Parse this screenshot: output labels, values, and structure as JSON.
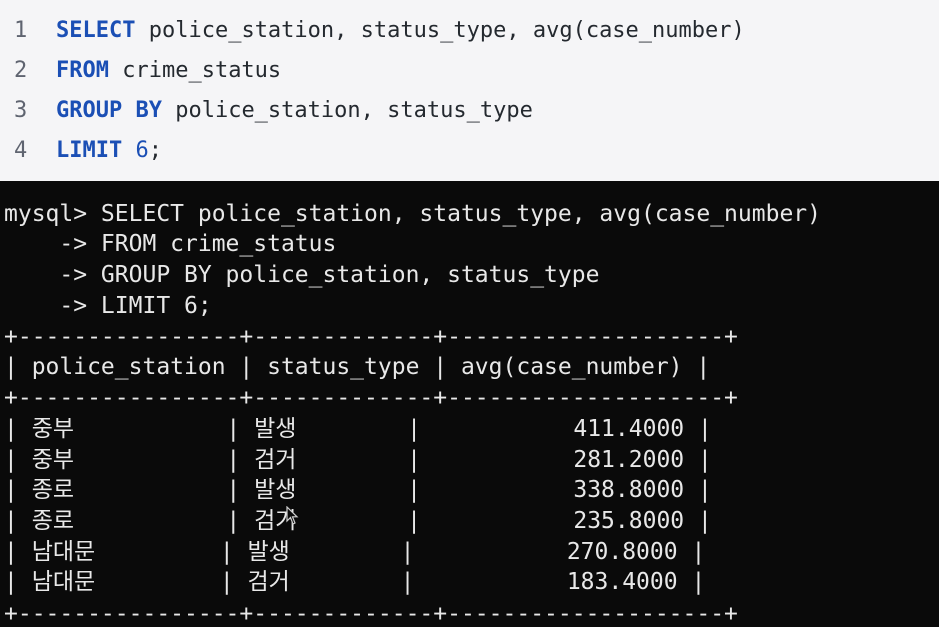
{
  "editor": {
    "lines": [
      {
        "num": "1",
        "kw1": "SELECT",
        "rest": " police_station, status_type, avg(case_number)"
      },
      {
        "num": "2",
        "kw1": "FROM",
        "rest": " crime_status"
      },
      {
        "num": "3",
        "kw1": "GROUP BY",
        "rest": " police_station, status_type"
      },
      {
        "num": "4",
        "kw1": "LIMIT",
        "rest_num": " 6",
        "rest": ";"
      }
    ]
  },
  "terminal": {
    "prompt_lines": [
      "mysql> SELECT police_station, status_type, avg(case_number)",
      "    -> FROM crime_status",
      "    -> GROUP BY police_station, status_type",
      "    -> LIMIT 6;"
    ],
    "border": "+----------------+-------------+--------------------+",
    "header": "| police_station | status_type | avg(case_number) |",
    "rows": [
      {
        "police_station": "중부",
        "status_type": "발생",
        "avg": "411.4000"
      },
      {
        "police_station": "중부",
        "status_type": "검거",
        "avg": "281.2000"
      },
      {
        "police_station": "종로",
        "status_type": "발생",
        "avg": "338.8000"
      },
      {
        "police_station": "종로",
        "status_type": "검거",
        "avg": "235.8000"
      },
      {
        "police_station": "남대문",
        "status_type": "발생",
        "avg": "270.8000"
      },
      {
        "police_station": "남대문",
        "status_type": "검거",
        "avg": "183.4000"
      }
    ]
  },
  "colors": {
    "keyword": "#1b4fb5",
    "terminal_bg": "#0a0a0a",
    "editor_bg": "#f5f5f7"
  }
}
